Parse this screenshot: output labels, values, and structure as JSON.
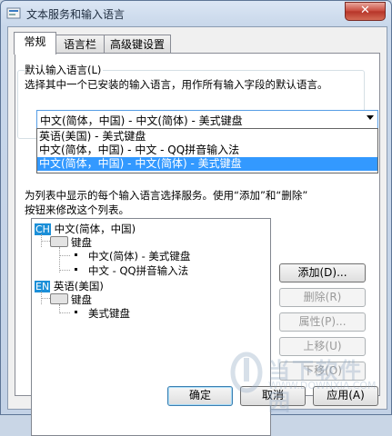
{
  "window": {
    "title": "文本服务和输入语言",
    "close_label": "✕"
  },
  "tabs": [
    {
      "label": "常规"
    },
    {
      "label": "语言栏"
    },
    {
      "label": "高级键设置"
    }
  ],
  "default_language": {
    "label": "默认输入语言(L)",
    "description": "选择其中一个已安装的输入语言，用作所有输入字段的默认语言。",
    "selected": "中文(简体，中国) - 中文(简体) - 美式键盘",
    "options": [
      "英语(美国) - 美式键盘",
      "中文(简体，中国) - 中文 - QQ拼音输入法",
      "中文(简体，中国) - 中文(简体) - 美式键盘"
    ]
  },
  "installed_services": {
    "description_line1": "为列表中显示的每个输入语言选择服务。使用“添加”和“删除”",
    "description_line2": "按钮来修改这个列表。"
  },
  "tree": {
    "lang1_badge": "CH",
    "lang1": "中文(简体，中国)",
    "lang1_group": "键盘",
    "lang1_items": [
      "中文(简体) - 美式键盘",
      "中文 - QQ拼音输入法"
    ],
    "lang2_badge": "EN",
    "lang2": "英语(美国)",
    "lang2_group": "键盘",
    "lang2_items": [
      "美式键盘"
    ]
  },
  "side_buttons": {
    "add": "添加(D)...",
    "remove": "删除(R)",
    "properties": "属性(P)...",
    "move_up": "上移(U)",
    "move_down": "下移(O)"
  },
  "bottom_buttons": {
    "ok": "确定",
    "cancel": "取消",
    "apply": "应用(A)"
  },
  "watermark": {
    "text": "当下软件园",
    "url": "WWW.DOWNXIA.COM"
  },
  "colors": {
    "selection": "#3399ff",
    "badge": "#1b8fd8"
  }
}
